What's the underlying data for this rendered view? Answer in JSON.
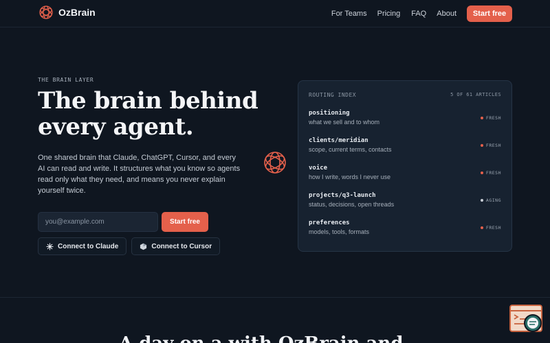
{
  "brand": {
    "name": "OzBrain",
    "accent": "#e4604b"
  },
  "nav": {
    "links": [
      "For Teams",
      "Pricing",
      "FAQ",
      "About"
    ],
    "cta": "Start free"
  },
  "hero": {
    "eyebrow": "THE BRAIN LAYER",
    "title": "The brain behind every agent.",
    "subtitle": "One shared brain that Claude, ChatGPT, Cursor, and every AI can read and write. It structures what you know so agents read only what they need, and means you never explain yourself twice.",
    "email_placeholder": "you@example.com",
    "signup_cta": "Start free",
    "connect_claude": "Connect to Claude",
    "connect_cursor": "Connect to Cursor"
  },
  "routing": {
    "title": "ROUTING INDEX",
    "count": "5 OF 61 ARTICLES",
    "rows": [
      {
        "name": "positioning",
        "desc": "what we sell and to whom",
        "status": "FRESH"
      },
      {
        "name": "clients/meridian",
        "desc": "scope, current terms, contacts",
        "status": "FRESH"
      },
      {
        "name": "voice",
        "desc": "how I write, words I never use",
        "status": "FRESH"
      },
      {
        "name": "projects/q3-launch",
        "desc": "status, decisions, open threads",
        "status": "AGING"
      },
      {
        "name": "preferences",
        "desc": "models, tools, formats",
        "status": "FRESH"
      }
    ]
  },
  "bottom": {
    "heading": "A day on a with  OzBrain and"
  }
}
